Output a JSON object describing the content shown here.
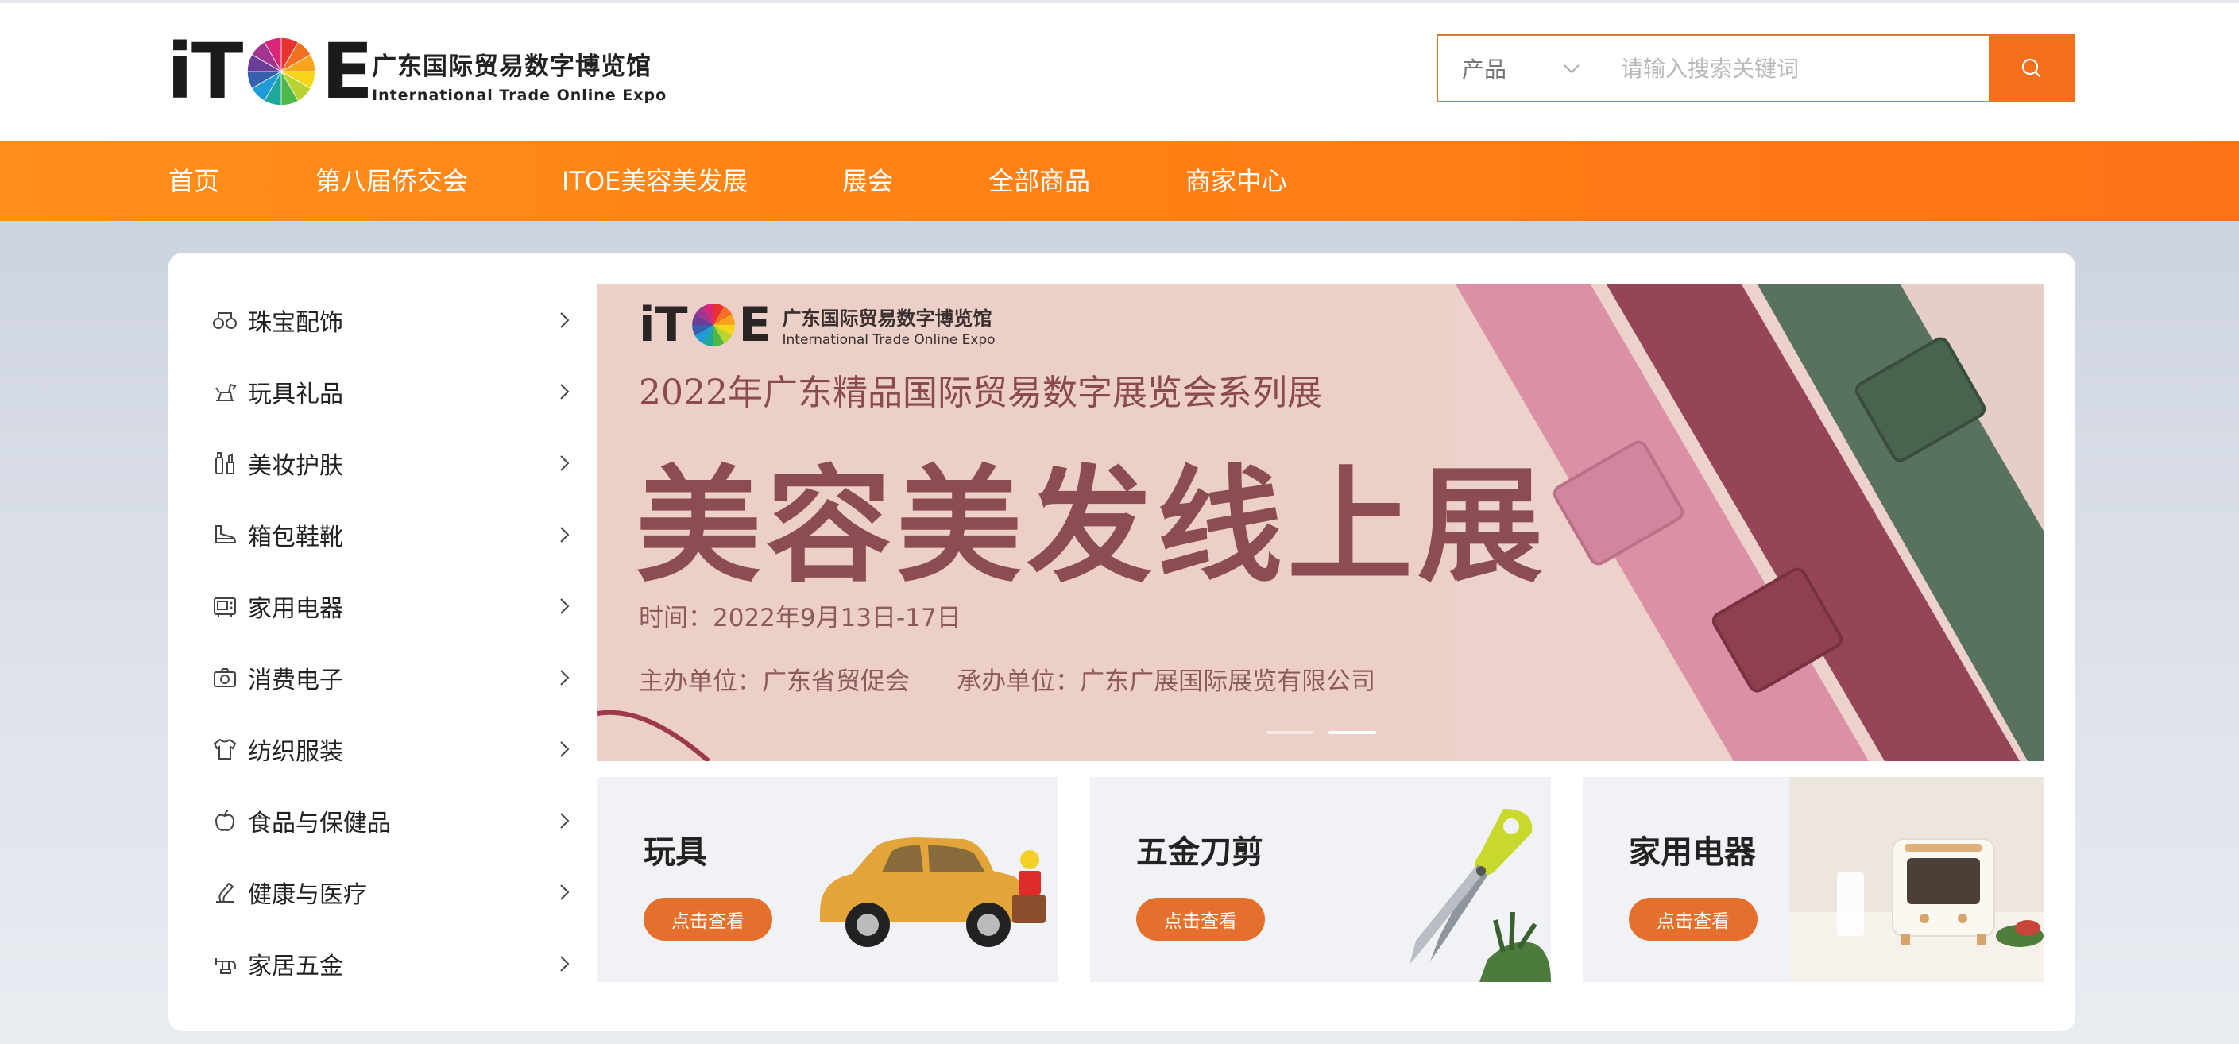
{
  "header": {
    "logo": {
      "letters_left": "iT",
      "letters_right": "E",
      "name_cn": "广东国际贸易数字博览馆",
      "name_en": "International Trade Online Expo"
    },
    "search": {
      "category": "产品",
      "placeholder": "请输入搜索关键词",
      "icon": "search-icon"
    }
  },
  "nav": {
    "items": [
      {
        "label": "首页"
      },
      {
        "label": "第八届侨交会"
      },
      {
        "label": "ITOE美容美发展"
      },
      {
        "label": "展会"
      },
      {
        "label": "全部商品"
      },
      {
        "label": "商家中心"
      }
    ]
  },
  "categories": [
    {
      "label": "珠宝配饰",
      "icon": "jewelry-icon"
    },
    {
      "label": "玩具礼品",
      "icon": "toy-horse-icon"
    },
    {
      "label": "美妆护肤",
      "icon": "cosmetics-icon"
    },
    {
      "label": "箱包鞋靴",
      "icon": "shoe-icon"
    },
    {
      "label": "家用电器",
      "icon": "appliance-icon"
    },
    {
      "label": "消费电子",
      "icon": "camera-icon"
    },
    {
      "label": "纺织服装",
      "icon": "clothing-icon"
    },
    {
      "label": "食品与保健品",
      "icon": "apple-icon"
    },
    {
      "label": "健康与医疗",
      "icon": "health-icon"
    },
    {
      "label": "家居五金",
      "icon": "faucet-icon"
    }
  ],
  "banner": {
    "logo_left": "iT",
    "logo_right": "E",
    "logo_cn": "广东国际贸易数字博览馆",
    "logo_en": "International Trade Online Expo",
    "subtitle": "2022年广东精品国际贸易数字展览会系列展",
    "title": "美容美发线上展",
    "time": "时间：2022年9月13日-17日",
    "organizer": "主办单位：广东省贸促会      承办单位：广东广展国际展览有限公司",
    "slides": 2,
    "active_slide": 2
  },
  "cards": [
    {
      "title": "玩具",
      "button": "点击查看"
    },
    {
      "title": "五金刀剪",
      "button": "点击查看"
    },
    {
      "title": "家用电器",
      "button": "点击查看"
    }
  ],
  "colors": {
    "accent": "#f56f1d",
    "nav_start": "#ff8e1a",
    "nav_end": "#ff7318",
    "card_button": "#e56f2c",
    "banner_bg": "#ecd0c8",
    "banner_text": "#8b4d51"
  }
}
